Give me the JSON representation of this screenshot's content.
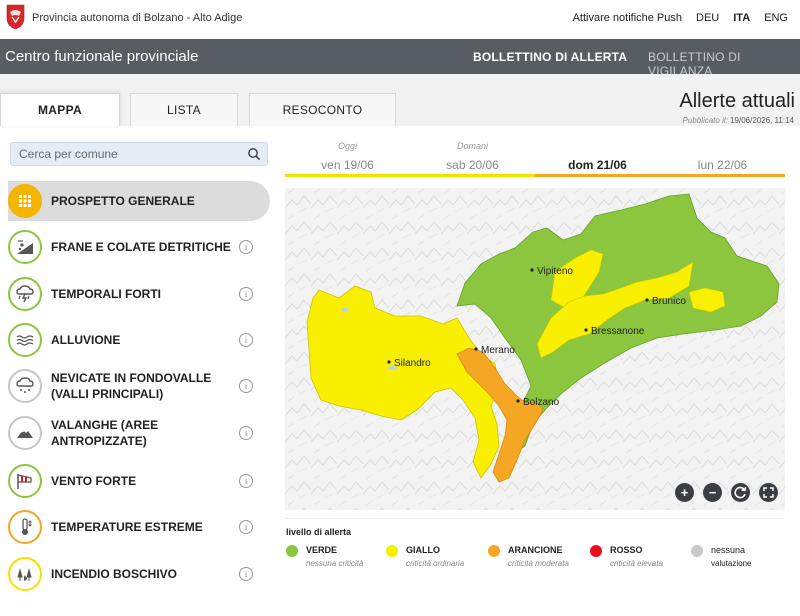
{
  "topbar": {
    "org": "Provincia autonoma di Bolzano - Alto Adige",
    "push": "Attivare notifiche Push",
    "languages": [
      "DEU",
      "ITA",
      "ENG"
    ]
  },
  "header": {
    "title": "Centro funzionale provinciale",
    "nav": [
      "BOLLETTINO DI ALLERTA",
      "BOLLETTINO DI VIGILANZA"
    ]
  },
  "tabs": [
    "MAPPA",
    "LISTA",
    "RESOCONTO"
  ],
  "page": {
    "title": "Allerte attuali",
    "published_label": "Pubblicato il:",
    "published_value": "19/06/2026, 11:14"
  },
  "search": {
    "placeholder": "Cerca per comune"
  },
  "hazards": [
    {
      "label": "PROSPETTO GENERALE",
      "icon": "grid-icon",
      "level": "overview"
    },
    {
      "label": "FRANE E COLATE DETRITICHE",
      "icon": "landslide-icon",
      "level": "green"
    },
    {
      "label": "TEMPORALI FORTI",
      "icon": "thunderstorm-icon",
      "level": "green"
    },
    {
      "label": "ALLUVIONE",
      "icon": "flood-icon",
      "level": "green"
    },
    {
      "label": "NEVICATE IN FONDOVALLE (VALLI PRINCIPALI)",
      "icon": "snowfall-icon",
      "level": "none"
    },
    {
      "label": "VALANGHE (AREE ANTROPIZZATE)",
      "icon": "avalanche-icon",
      "level": "none"
    },
    {
      "label": "VENTO FORTE",
      "icon": "windsock-icon",
      "level": "green"
    },
    {
      "label": "TEMPERATURE ESTREME",
      "icon": "thermometer-icon",
      "level": "orange"
    },
    {
      "label": "INCENDIO BOSCHIVO",
      "icon": "forest-fire-icon",
      "level": "yellow"
    }
  ],
  "days": [
    {
      "caption": "Oggi",
      "label": "ven 19/06"
    },
    {
      "caption": "Domani",
      "label": "sab 20/06"
    },
    {
      "caption": "",
      "label": "dom 21/06"
    },
    {
      "caption": "",
      "label": "lun 22/06"
    }
  ],
  "map": {
    "towns": [
      "Vipiteno",
      "Brunico",
      "Bressanone",
      "Merano",
      "Silandro",
      "Bolzano"
    ],
    "controls": [
      "zoom-in",
      "zoom-out",
      "reset",
      "fullscreen"
    ],
    "zoom_in_label": "+",
    "zoom_out_label": "−"
  },
  "legend": {
    "title": "livello di allerta",
    "items": [
      {
        "name": "VERDE",
        "sub": "nessuna criticità",
        "color": "#8cc63f"
      },
      {
        "name": "GIALLO",
        "sub": "criticità ordinaria",
        "color": "#f8f000"
      },
      {
        "name": "ARANCIONE",
        "sub": "criticità moderata",
        "color": "#f5a623"
      },
      {
        "name": "ROSSO",
        "sub": "criticità elevata",
        "color": "#e8101a"
      },
      {
        "name": "nessuna",
        "sub": "valutazione",
        "color": "#c8c8c8"
      }
    ]
  },
  "colors": {
    "header_bg": "#585d63",
    "green": "#8cc63f",
    "yellow": "#f8f000",
    "orange": "#f5a623",
    "active_day_line": "#f5a623"
  }
}
